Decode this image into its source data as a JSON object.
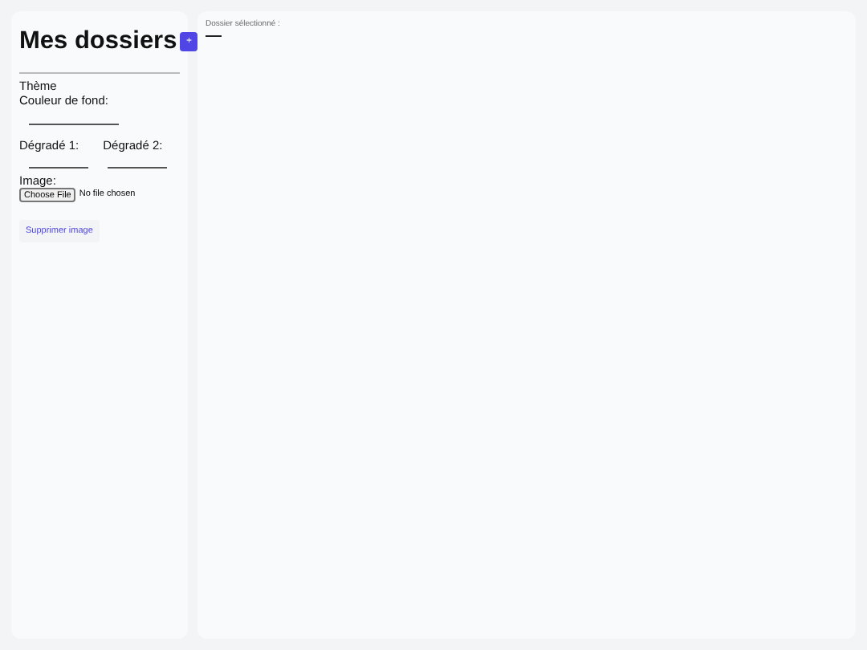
{
  "sidebar": {
    "title": "Mes dossiers",
    "add_button": "+",
    "theme_label": "Thème",
    "background_label": "Couleur de fond:",
    "gradient_1_label": "Dégradé 1:",
    "gradient_2_label": "Dégradé 2:",
    "image_label": "Image:",
    "file_button": "Choose File",
    "file_status": "No file chosen",
    "remove_image": "Supprimer image"
  },
  "main": {
    "selected_folder_label": "Dossier sélectionné :"
  }
}
